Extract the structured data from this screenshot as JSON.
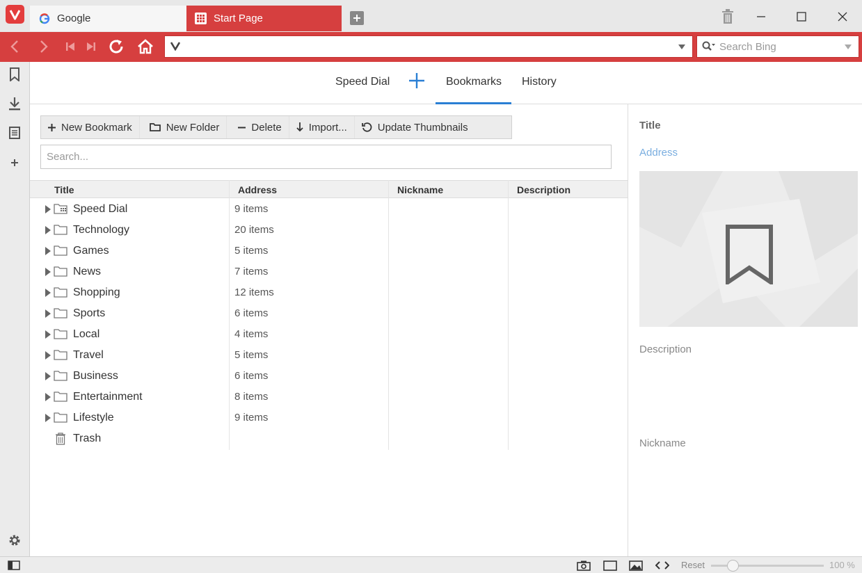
{
  "tabs": [
    {
      "label": "Google",
      "icon": "google-icon"
    },
    {
      "label": "Start Page",
      "icon": "speed-dial-grid-icon"
    }
  ],
  "address_bar": {
    "url_value": "",
    "search_placeholder": "Search Bing"
  },
  "main_tabs": {
    "speed_dial": "Speed Dial",
    "bookmarks": "Bookmarks",
    "history": "History",
    "active": "Bookmarks"
  },
  "toolbar": {
    "new_bookmark": "New Bookmark",
    "new_folder": "New Folder",
    "delete": "Delete",
    "import": "Import...",
    "update_thumbnails": "Update Thumbnails"
  },
  "search": {
    "placeholder": "Search..."
  },
  "table": {
    "headers": {
      "title": "Title",
      "address": "Address",
      "nickname": "Nickname",
      "description": "Description"
    },
    "rows": [
      {
        "title": "Speed Dial",
        "address": "9 items",
        "icon": "speed-dial-folder-icon"
      },
      {
        "title": "Technology",
        "address": "20 items",
        "icon": "folder-icon"
      },
      {
        "title": "Games",
        "address": "5 items",
        "icon": "folder-icon"
      },
      {
        "title": "News",
        "address": "7 items",
        "icon": "folder-icon"
      },
      {
        "title": "Shopping",
        "address": "12 items",
        "icon": "folder-icon"
      },
      {
        "title": "Sports",
        "address": "6 items",
        "icon": "folder-icon"
      },
      {
        "title": "Local",
        "address": "4 items",
        "icon": "folder-icon"
      },
      {
        "title": "Travel",
        "address": "5 items",
        "icon": "folder-icon"
      },
      {
        "title": "Business",
        "address": "6 items",
        "icon": "folder-icon"
      },
      {
        "title": "Entertainment",
        "address": "8 items",
        "icon": "folder-icon"
      },
      {
        "title": "Lifestyle",
        "address": "9 items",
        "icon": "folder-icon"
      },
      {
        "title": "Trash",
        "address": "",
        "icon": "trash-icon"
      }
    ]
  },
  "detail": {
    "title": "Title",
    "address": "Address",
    "description": "Description",
    "nickname": "Nickname"
  },
  "status": {
    "reset": "Reset",
    "zoom": "100 %"
  },
  "colors": {
    "brand_red": "#d63f3f",
    "accent_blue": "#2a7fd4",
    "address_link": "#7aaee0"
  }
}
